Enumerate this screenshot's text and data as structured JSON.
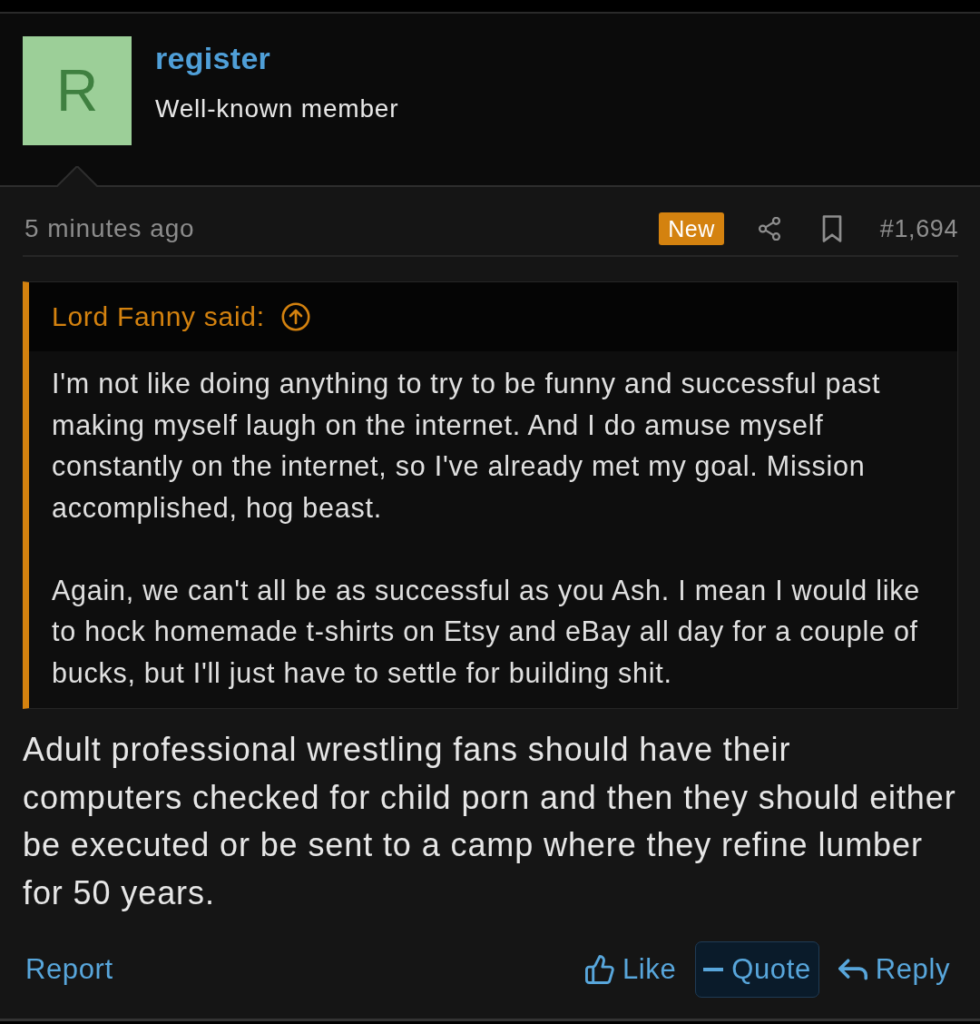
{
  "post": {
    "author": {
      "avatar_letter": "R",
      "username": "register",
      "title": "Well-known member"
    },
    "meta": {
      "time": "5 minutes ago",
      "badge": "New",
      "post_number": "#1,694"
    },
    "quote": {
      "attribution": "Lord Fanny said:",
      "paragraphs": [
        "I'm not like doing anything to try to be funny and successful past making myself laugh on the internet. And I do amuse myself constantly on the internet, so I've already met my goal. Mission accomplished, hog beast.",
        "Again, we can't all be as successful as you Ash. I mean I would like to hock homemade t-shirts on Etsy and eBay all day for a couple of bucks, but I'll just have to settle for building shit."
      ]
    },
    "body": "Adult professional wrestling fans should have their computers checked for child porn and then they should either be executed or be sent to a camp where they refine lumber for 50 years.",
    "actions": {
      "report": "Report",
      "buttons": [
        {
          "kind": "like",
          "label": "Like",
          "selected": false
        },
        {
          "kind": "quote",
          "label": "Quote",
          "selected": true
        },
        {
          "kind": "reply",
          "label": "Reply",
          "selected": false
        }
      ]
    }
  }
}
